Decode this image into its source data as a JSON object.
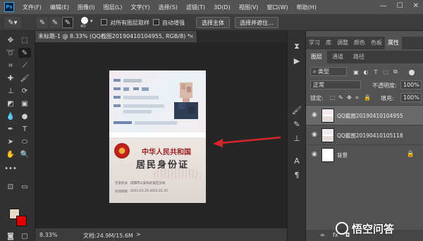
{
  "app": {
    "logo": "Ps"
  },
  "menu": [
    "文件(F)",
    "编辑(E)",
    "图像(I)",
    "图层(L)",
    "文字(Y)",
    "选择(S)",
    "滤镜(T)",
    "3D(D)",
    "视图(V)",
    "窗口(W)",
    "帮助(H)"
  ],
  "window_controls": {
    "minimize": "—",
    "maximize": "☐",
    "close": "✕"
  },
  "options_bar": {
    "brush_size": "40",
    "sample_all_label": "对所有图层取样",
    "auto_enhance_label": "自动增强",
    "select_subject": "选择主体",
    "select_and_mask": "选择并遮住..."
  },
  "document_tab": {
    "title": "未标题-1 @ 8.33% (QQ截图20190410104955, RGB/8) *",
    "close": "×"
  },
  "id_card": {
    "back_title_1": "中华人民共和国",
    "back_title_2": "居民身份证",
    "issuer_label": "签发机关",
    "issuer_value": "成都市公安局武侯区分局",
    "valid_label": "有效期限",
    "valid_value": "2011.01.25-2021.01.25"
  },
  "right_dock_top_tabs": [
    "学习",
    "库",
    "调整",
    "颜色",
    "色板",
    "属性"
  ],
  "layers_panel": {
    "tabs": [
      "图层",
      "通道",
      "路径"
    ],
    "filter_label": "类型",
    "blend_mode": "正常",
    "opacity_label": "不透明度:",
    "opacity_value": "100%",
    "lock_label": "锁定:",
    "fill_label": "填充:",
    "fill_value": "100%",
    "layers": [
      {
        "name": "QQ截图20190410104955",
        "visible": true,
        "selected": true
      },
      {
        "name": "QQ截图20190410105118",
        "visible": true,
        "selected": false
      },
      {
        "name": "背景",
        "visible": true,
        "selected": false,
        "locked": true
      }
    ]
  },
  "status_bar": {
    "zoom": "8.33%",
    "doc_size": "文档:24.9M/15.6M",
    "arrow": ">"
  },
  "watermark": {
    "text": "悟空问答"
  },
  "colors": {
    "foreground": "#e6d7c8",
    "background": "#e00000",
    "arrow": "#d9252a"
  }
}
